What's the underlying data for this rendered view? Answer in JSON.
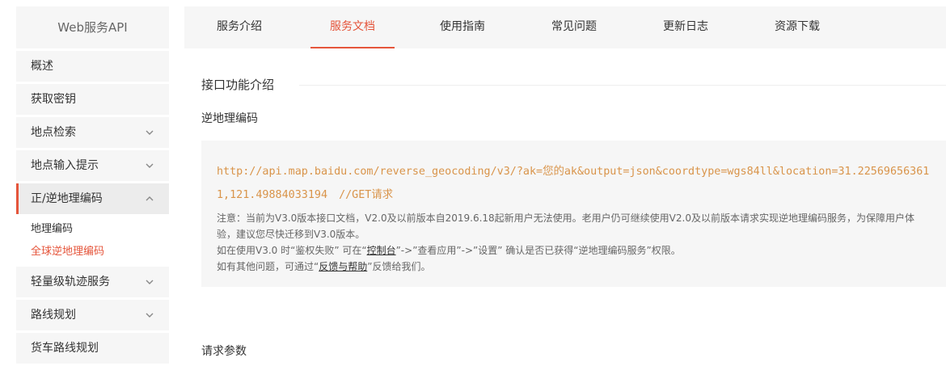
{
  "sidebar": {
    "title": "Web服务API",
    "items": [
      {
        "label": "概述"
      },
      {
        "label": "获取密钥"
      },
      {
        "label": "地点检索"
      },
      {
        "label": "地点输入提示"
      },
      {
        "label": "正/逆地理编码"
      },
      {
        "label": "轻量级轨迹服务"
      },
      {
        "label": "路线规划"
      },
      {
        "label": "货车路线规划"
      }
    ],
    "sub_items": [
      {
        "label": "地理编码"
      },
      {
        "label": "全球逆地理编码"
      }
    ]
  },
  "tabs": [
    {
      "label": "服务介绍"
    },
    {
      "label": "服务文档"
    },
    {
      "label": "使用指南"
    },
    {
      "label": "常见问题"
    },
    {
      "label": "更新日志"
    },
    {
      "label": "资源下载"
    }
  ],
  "content": {
    "section_title": "接口功能介绍",
    "subtitle": "逆地理编码",
    "code_url": "http://api.map.baidu.com/reverse_geocoding/v3/?ak=您的ak&output=json&coordtype=wgs84ll&location=31.225696563611,121.49884033194",
    "code_comment": "//GET请求",
    "note1": "注意：当前为V3.0版本接口文档，V2.0及以前版本自2019.6.18起新用户无法使用。老用户仍可继续使用V2.0及以前版本请求实现逆地理编码服务，为保障用户体验，建议您尽快迁移到V3.0版本。",
    "note2_a": "如在使用V3.0 时“鉴权失败” 可在“",
    "note2_link": "控制台",
    "note2_b": "”->”查看应用”->”设置” 确认是否已获得“逆地理编码服务”权限。",
    "note3_a": "如有其他问题，可通过“",
    "note3_link": "反馈与帮助",
    "note3_b": "”反馈给我们。",
    "request_params_title": "请求参数"
  },
  "colors": {
    "accent": "#e5553b",
    "code": "#d9944a",
    "sidebar_bg": "#f6f6f6"
  },
  "icons": {
    "expand": "chevron-down-icon",
    "collapse": "chevron-up-icon"
  }
}
